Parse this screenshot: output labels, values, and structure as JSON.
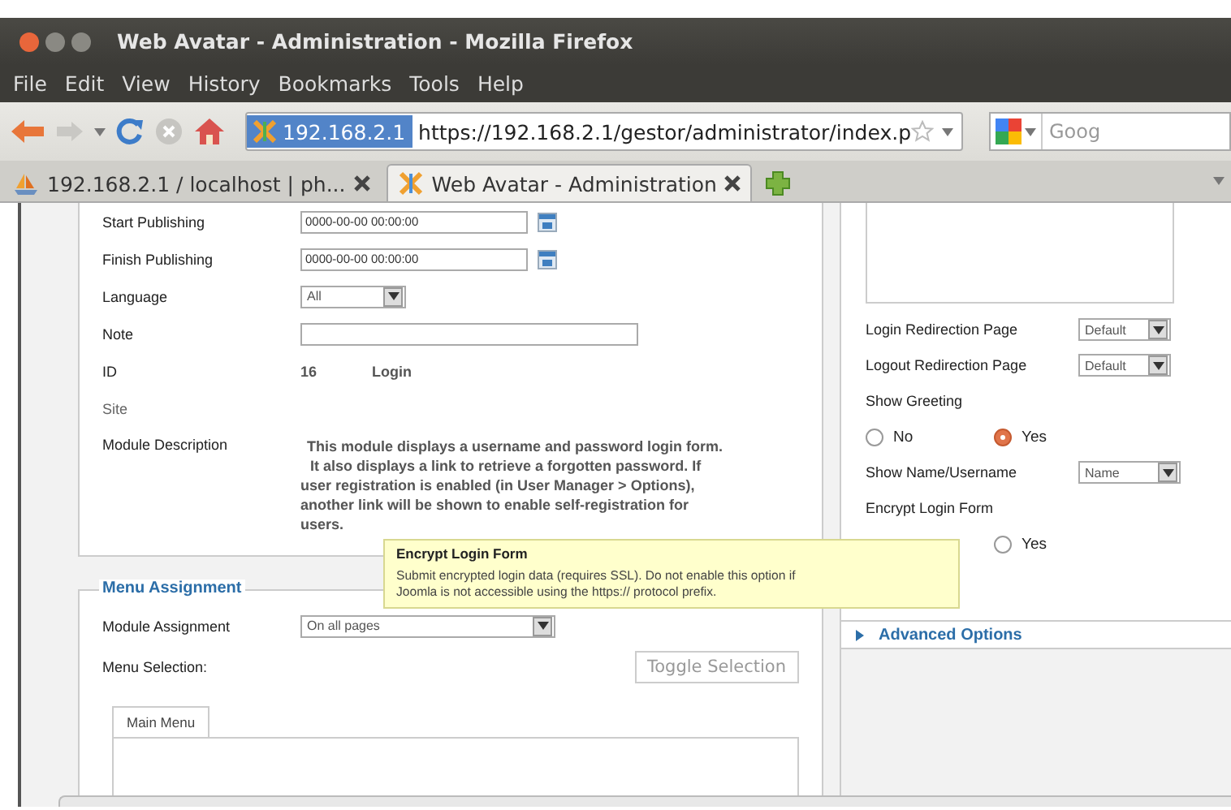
{
  "window": {
    "title": "Web Avatar - Administration - Mozilla Firefox"
  },
  "menu": [
    {
      "label": "File"
    },
    {
      "label": "Edit"
    },
    {
      "label": "View"
    },
    {
      "label": "History"
    },
    {
      "label": "Bookmarks"
    },
    {
      "label": "Tools"
    },
    {
      "label": "Help"
    }
  ],
  "toolbar": {
    "site_badge": "192.168.2.1",
    "url": "https://192.168.2.1/gestor/administrator/index.p",
    "search_placeholder": "Goog"
  },
  "tabs": [
    {
      "label": "192.168.2.1 / localhost | ph...",
      "selected": false
    },
    {
      "label": "Web Avatar - Administration",
      "selected": true
    }
  ],
  "details": {
    "fields": [
      {
        "kind": "date",
        "label": "Start Publishing",
        "value": "0000-00-00 00:00:00"
      },
      {
        "kind": "date",
        "label": "Finish Publishing",
        "value": "0000-00-00 00:00:00"
      },
      {
        "kind": "select",
        "label": "Language",
        "value": "All"
      },
      {
        "kind": "text",
        "label": "Note"
      },
      {
        "kind": "static",
        "label": "ID",
        "value": "16",
        "extra": "Login"
      },
      {
        "kind": "label",
        "label": "Site"
      },
      {
        "kind": "description",
        "label": "Module Description",
        "lines": [
          "This module displays a username and password login form.",
          "It also displays a link to retrieve a forgotten password. If",
          "user registration is enabled (in User Manager > Options),",
          "another link will be shown to enable self-registration for",
          "users."
        ]
      }
    ]
  },
  "menu_assignment": {
    "legend": "Menu Assignment",
    "module_assignment": {
      "label": "Module Assignment",
      "value": "On all pages"
    },
    "menu_selection_label": "Menu Selection:",
    "toggle_button": "Toggle Selection",
    "menu_tabs": [
      {
        "label": "Main Menu",
        "selected": true
      }
    ]
  },
  "options": {
    "fields": [
      {
        "kind": "select",
        "label": "Login Redirection Page",
        "value": "Default"
      },
      {
        "kind": "select",
        "label": "Logout Redirection Page",
        "value": "Default"
      },
      {
        "kind": "radio",
        "label": "Show Greeting",
        "options": [
          {
            "label": "No",
            "selected": false
          },
          {
            "label": "Yes",
            "selected": true
          }
        ]
      },
      {
        "kind": "select",
        "label": "Show Name/Username",
        "value": "Name"
      },
      {
        "kind": "radio",
        "label": "Encrypt Login Form",
        "options": [
          {
            "label": "Yes",
            "selected": false
          }
        ]
      }
    ]
  },
  "advanced": {
    "label": "Advanced Options",
    "expanded": false
  },
  "tooltip": {
    "title": "Encrypt Login Form",
    "lines": [
      "Submit encrypted login data (requires SSL). Do not enable this option if",
      "Joomla is not accessible using the https:// protocol prefix."
    ]
  }
}
